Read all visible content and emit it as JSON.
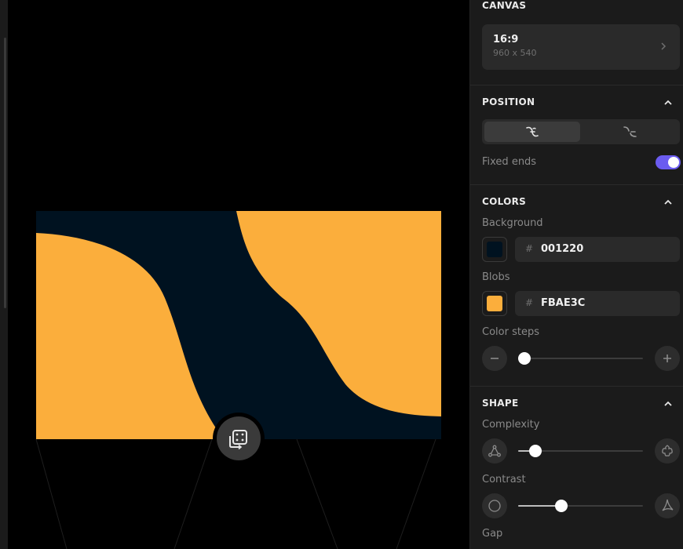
{
  "canvas": {
    "section_title": "CANVAS",
    "ratio": "16:9",
    "dimensions": "960 x 540"
  },
  "position": {
    "section_title": "POSITION",
    "fixed_ends_label": "Fixed ends",
    "fixed_ends": true
  },
  "colors": {
    "section_title": "COLORS",
    "background_label": "Background",
    "background_hash": "#",
    "background_hex": "001220",
    "background_color": "#001220",
    "blobs_label": "Blobs",
    "blobs_hash": "#",
    "blobs_hex": "FBAE3C",
    "blobs_color": "#FBAE3C",
    "color_steps_label": "Color steps",
    "color_steps_value": 0
  },
  "shape": {
    "section_title": "SHAPE",
    "complexity_label": "Complexity",
    "complexity_value": 0.1,
    "contrast_label": "Contrast",
    "contrast_value": 0.33,
    "gap_label": "Gap"
  },
  "accent_color": "#6B5CF0",
  "icons": {
    "canvas_chevron": "chevron-right-icon",
    "section_collapse": "chevron-up-icon",
    "randomize": "dice-icon"
  }
}
